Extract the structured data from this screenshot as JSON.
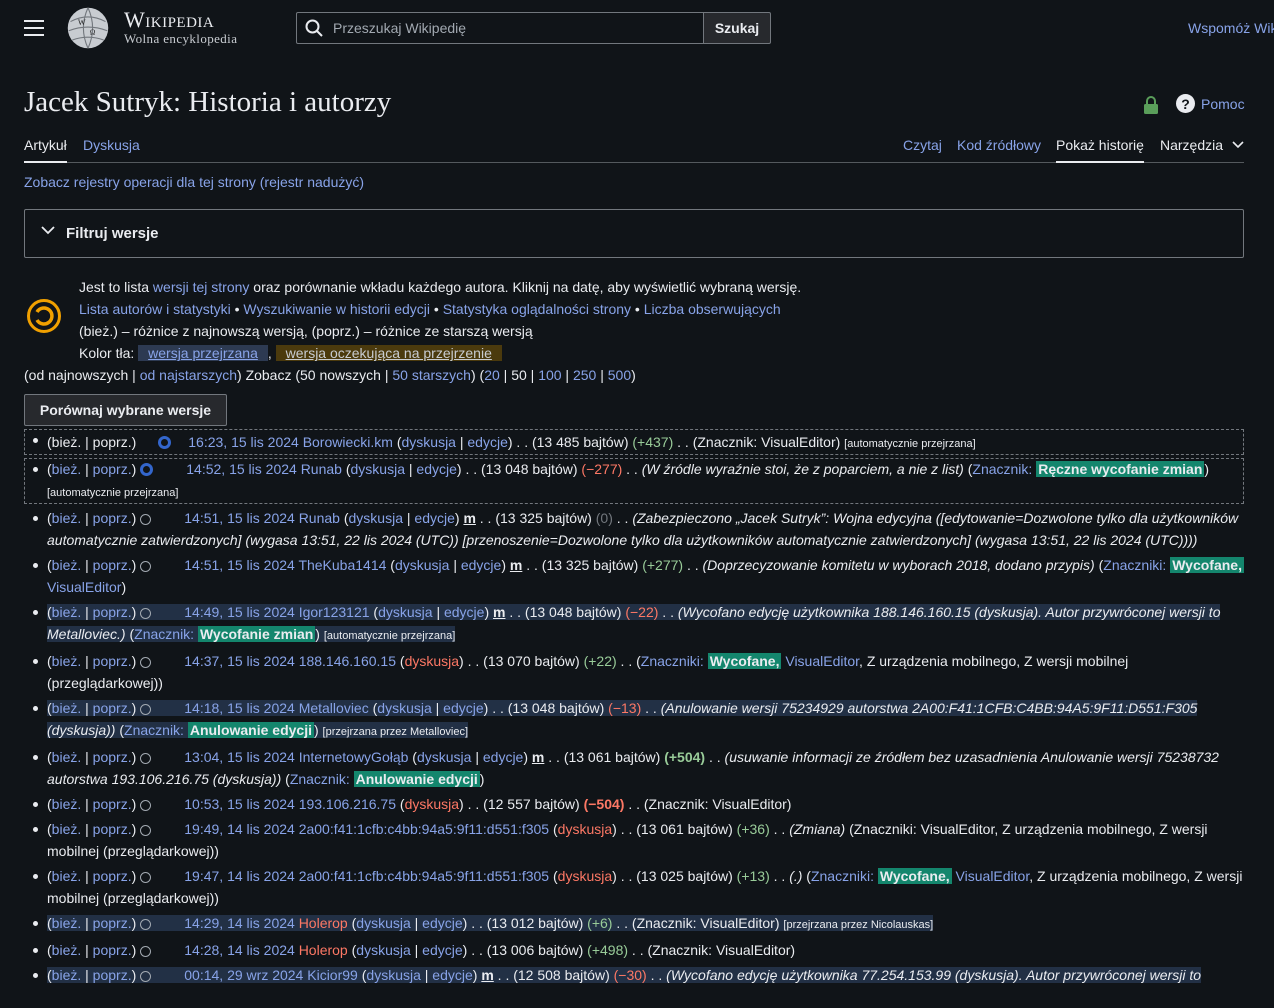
{
  "header": {
    "wordmark_title": "Wikipedia",
    "wordmark_tagline": "Wolna encyklopedia",
    "search_placeholder": "Przeszukaj Wikipedię",
    "search_button": "Szukaj",
    "donate": "Wspomóż Wik"
  },
  "page": {
    "title": "Jacek Sutryk: Historia i autorzy",
    "help": "Pomoc"
  },
  "tabs": {
    "left": [
      "Artykuł",
      "Dyskusja"
    ],
    "right": [
      "Czytaj",
      "Kod źródłowy",
      "Pokaż historię",
      "Narzędzia"
    ]
  },
  "logs_link": "Zobacz rejestry operacji dla tej strony (rejestr nadużyć)",
  "filter_title": "Filtruj wersje",
  "info": {
    "line1_a": "Jest to lista ",
    "line1_link": "wersji tej strony",
    "line1_b": " oraz porównanie wkładu każdego autora. Kliknij na datę, aby wyświetlić wybraną wersję.",
    "links": [
      "Lista autorów i statystyki",
      "Wyszukiwanie w historii edycji",
      "Statystyka oglądalności strony",
      "Liczba obserwujących"
    ],
    "legend": "(bież.) – różnice z najnowszą wersją, (poprz.) – różnice ze starszą wersją",
    "color_label": "Kolor tła: ",
    "color_a": "wersja przejrzana",
    "color_b": "wersja oczekująca na przejrzenie"
  },
  "nav": {
    "newest": "od najnowszych",
    "oldest": "od najstarszych",
    "see": "Zobacz (50 nowszych | ",
    "older": "50 starszych",
    "counts": [
      "20",
      "50",
      "100",
      "250",
      "500"
    ]
  },
  "compare_button": "Porównaj wybrane wersje",
  "history": [
    {
      "cur": "bież.",
      "prev": "poprz.",
      "date": "16:23, 15 lis 2024",
      "user": "Borowiecki.km",
      "talk": "dyskusja",
      "contribs": "edycje",
      "size": "(13 485 bajtów)",
      "diff": "(+437)",
      "diffcls": "pos",
      "tail": "(Znacznik: VisualEditor)",
      "extra": "[automatycznie przejrzana]"
    },
    {
      "cur": "bież.",
      "prev": "poprz.",
      "date": "14:52, 15 lis 2024",
      "user": "Runab",
      "talk": "dyskusja",
      "contribs": "edycje",
      "size": "(13 048 bajtów)",
      "diff": "(−277)",
      "diffcls": "neg",
      "comment": "(W źródle wyraźnie stoi, że z poparciem, a nie z list)",
      "tag_label": "Znacznik:",
      "tag": "Ręczne wycofanie zmian",
      "extra": "[automatycznie przejrzana]"
    },
    {
      "cur": "bież.",
      "prev": "poprz.",
      "date": "14:51, 15 lis 2024",
      "user": "Runab",
      "talk": "dyskusja",
      "contribs": "edycje",
      "minor": "m",
      "size": "(13 325 bajtów)",
      "diff": "(0)",
      "diffcls": "zero",
      "comment": "(Zabezpieczono „Jacek Sutryk”: Wojna edycyjna ([edytowanie=Dozwolone tylko dla użytkowników automatycznie zatwierdzonych] (wygasa 13:51, 22 lis 2024 (UTC)) [przenoszenie=Dozwolone tylko dla użytkowników automatycznie zatwierdzonych] (wygasa 13:51, 22 lis 2024 (UTC))))"
    },
    {
      "cur": "bież.",
      "prev": "poprz.",
      "date": "14:51, 15 lis 2024",
      "user": "TheKuba1414",
      "talk": "dyskusja",
      "contribs": "edycje",
      "minor": "m",
      "size": "(13 325 bajtów)",
      "diff": "(+277)",
      "diffcls": "pos",
      "comment": "(Doprzecyzowanie komitetu w wyborach 2018, dodano przypis)",
      "tag_label": "Znaczniki:",
      "tag": "Wycofane,",
      "tag2": "VisualEditor"
    },
    {
      "cur": "bież.",
      "prev": "poprz.",
      "date": "14:49, 15 lis 2024",
      "user": "Igor123121",
      "talk": "dyskusja",
      "contribs": "edycje",
      "minor": "m",
      "size": "(13 048 bajtów)",
      "diff": "(−22)",
      "diffcls": "neg",
      "comment": "(Wycofano edycję użytkownika 188.146.160.15 (dyskusja). Autor przywróconej wersji to Metalloviec.)",
      "tag_label": "Znacznik:",
      "tag": "Wycofanie zmian",
      "extra": "[automatycznie przejrzana]",
      "pending": true
    },
    {
      "cur": "bież.",
      "prev": "poprz.",
      "date": "14:37, 15 lis 2024",
      "user": "188.146.160.15",
      "talk": "dyskusja",
      "size": "(13 070 bajtów)",
      "diff": "(+22)",
      "diffcls": "pos",
      "tag_label": "Znaczniki:",
      "tag": "Wycofane,",
      "tag2": "VisualEditor",
      "tail": ", Z urządzenia mobilnego, Z wersji mobilnej (przeglądarkowej))"
    },
    {
      "cur": "bież.",
      "prev": "poprz.",
      "date": "14:18, 15 lis 2024",
      "user": "Metalloviec",
      "talk": "dyskusja",
      "contribs": "edycje",
      "size": "(13 048 bajtów)",
      "diff": "(−13)",
      "diffcls": "neg",
      "comment": "(Anulowanie wersji 75234929 autorstwa 2A00:F41:1CFB:C4BB:94A5:9F11:D551:F305 (dyskusja))",
      "tag_label": "Znacznik:",
      "tag": "Anulowanie edycji",
      "extra": "[przejrzana przez Metalloviec]",
      "pending": true
    },
    {
      "cur": "bież.",
      "prev": "poprz.",
      "date": "13:04, 15 lis 2024",
      "user": "InternetowyGołąb",
      "talk": "dyskusja",
      "contribs": "edycje",
      "minor": "m",
      "size": "(13 061 bajtów)",
      "diff": "(+504)",
      "diffcls": "pos bold",
      "comment": "(usuwanie informacji ze źródłem bez uzasadnienia Anulowanie wersji 75238732 autorstwa 193.106.216.75 (dyskusja))",
      "tag_label": "Znacznik:",
      "tag": "Anulowanie edycji"
    },
    {
      "cur": "bież.",
      "prev": "poprz.",
      "date": "10:53, 15 lis 2024",
      "user": "193.106.216.75",
      "talk": "dyskusja",
      "size": "(12 557 bajtów)",
      "diff": "(−504)",
      "diffcls": "neg bold",
      "tail": "(Znacznik: VisualEditor)"
    },
    {
      "cur": "bież.",
      "prev": "poprz.",
      "date": "19:49, 14 lis 2024",
      "user": "2a00:f41:1cfb:c4bb:94a5:9f11:d551:f305",
      "talk": "dyskusja",
      "size": "(13 061 bajtów)",
      "diff": "(+36)",
      "diffcls": "pos",
      "comment": "(Zmiana)",
      "tail": "(Znaczniki: VisualEditor, Z urządzenia mobilnego, Z wersji mobilnej (przeglądarkowej))"
    },
    {
      "cur": "bież.",
      "prev": "poprz.",
      "date": "19:47, 14 lis 2024",
      "user": "2a00:f41:1cfb:c4bb:94a5:9f11:d551:f305",
      "talk": "dyskusja",
      "size": "(13 025 bajtów)",
      "diff": "(+13)",
      "diffcls": "pos",
      "comment": "(.)",
      "tag_label": "Znaczniki:",
      "tag": "Wycofane,",
      "tag2": "VisualEditor",
      "tail": ", Z urządzenia mobilnego, Z wersji mobilnej (przeglądarkowej))"
    },
    {
      "cur": "bież.",
      "prev": "poprz.",
      "date": "14:29, 14 lis 2024",
      "user": "Holerop",
      "talk": "dyskusja",
      "contribs": "edycje",
      "size": "(13 012 bajtów)",
      "diff": "(+6)",
      "diffcls": "pos",
      "tail": "(Znacznik: VisualEditor)",
      "extra": "[przejrzana przez Nicolauskas]",
      "pending": true
    },
    {
      "cur": "bież.",
      "prev": "poprz.",
      "date": "14:28, 14 lis 2024",
      "user": "Holerop",
      "talk": "dyskusja",
      "contribs": "edycje",
      "size": "(13 006 bajtów)",
      "diff": "(+498)",
      "diffcls": "pos",
      "tail": "(Znacznik: VisualEditor)"
    },
    {
      "cur": "bież.",
      "prev": "poprz.",
      "date": "00:14, 29 wrz 2024",
      "user": "Kicior99",
      "talk": "dyskusja",
      "contribs": "edycje",
      "minor": "m",
      "size": "(12 508 bajtów)",
      "diff": "(−30)",
      "diffcls": "neg",
      "comment": "(Wycofano edycję użytkownika 77.254.153.99 (dyskusja). Autor przywróconej wersji to",
      "pending": true
    }
  ],
  "colors": {
    "accent": "#88a3e8",
    "background": "#101418",
    "tag": "#14866d",
    "negative": "#fd7865",
    "positive": "#99cc99"
  }
}
